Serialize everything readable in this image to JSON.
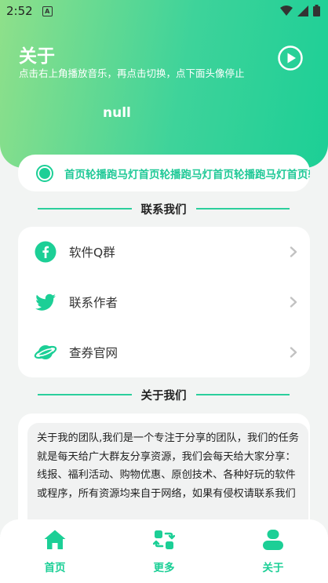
{
  "status_bar": {
    "time": "2:52",
    "app_badge": "A"
  },
  "header": {
    "title": "关于",
    "subtitle": "点击右上角播放音乐，再点击切换，点下面头像停止",
    "nickname": "null"
  },
  "marquee": {
    "text": "首页轮播跑马灯首页轮播跑马灯首页轮播跑马灯首页轮播跑马灯"
  },
  "sections": {
    "contact": "联系我们",
    "about": "关于我们"
  },
  "contact_items": [
    {
      "label": "软件Q群",
      "icon": "facebook-icon"
    },
    {
      "label": "联系作者",
      "icon": "twitter-icon"
    },
    {
      "label": "查券官网",
      "icon": "planet-icon"
    }
  ],
  "about_text": "关于我的团队,我们是一个专注于分享的团队，我们的任务就是每天给广大群友分享资源，我们会每天给大家分享：线报、福利活动、购物优惠、原创技术、各种好玩的软件或程序，所有资源均来自于网络，如果有侵权请联系我们",
  "bottom_nav": [
    {
      "label": "首页",
      "icon": "home-icon"
    },
    {
      "label": "更多",
      "icon": "switch-icon"
    },
    {
      "label": "关于",
      "icon": "user-icon"
    }
  ],
  "colors": {
    "accent": "#1ccf96",
    "gradient_start": "#8fe08a",
    "background": "#f2f4f3"
  }
}
